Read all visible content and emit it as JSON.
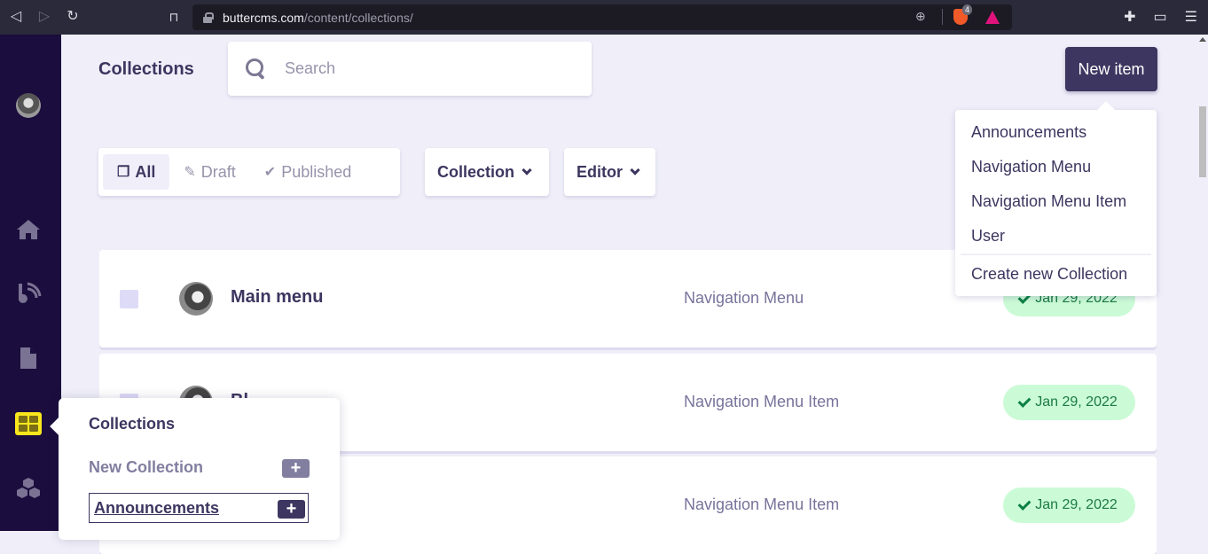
{
  "browser": {
    "url_domain": "buttercms.com",
    "url_path": "/content/collections/",
    "shield_count": "4"
  },
  "header": {
    "title": "Collections",
    "search_placeholder": "Search",
    "new_item_label": "New item"
  },
  "filters": {
    "tabs": [
      {
        "label": "All",
        "icon": "copy-icon",
        "active": true
      },
      {
        "label": "Draft",
        "icon": "pencil-icon",
        "active": false
      },
      {
        "label": "Published",
        "icon": "check-icon",
        "active": false
      }
    ],
    "collection_dropdown": "Collection",
    "editor_dropdown": "Editor"
  },
  "new_item_menu": {
    "items": [
      "Announcements",
      "Navigation Menu",
      "Navigation Menu Item",
      "User"
    ],
    "create_label": "Create new Collection"
  },
  "rows": [
    {
      "name": "Main menu",
      "type": "Navigation Menu",
      "status": "Jan 29, 2022"
    },
    {
      "name": "Bl...",
      "type": "Navigation Menu Item",
      "status": "Jan 29, 2022"
    },
    {
      "name": "",
      "type": "Navigation Menu Item",
      "status": "Jan 29, 2022"
    }
  ],
  "flyout": {
    "title": "Collections",
    "new_collection_label": "New Collection",
    "items": [
      {
        "label": "Announcements"
      }
    ],
    "plus_glyph": "+"
  },
  "sidebar": {
    "items": [
      "avatar",
      "home-icon",
      "blog-icon",
      "pages-icon",
      "collections-icon",
      "components-icon"
    ]
  },
  "colors": {
    "primary": "#3d3660",
    "sidebar_bg": "#1b0d3d",
    "active_icon": "#f8e71c",
    "status_bg": "#cbfbd6",
    "status_text": "#1b7a43"
  }
}
